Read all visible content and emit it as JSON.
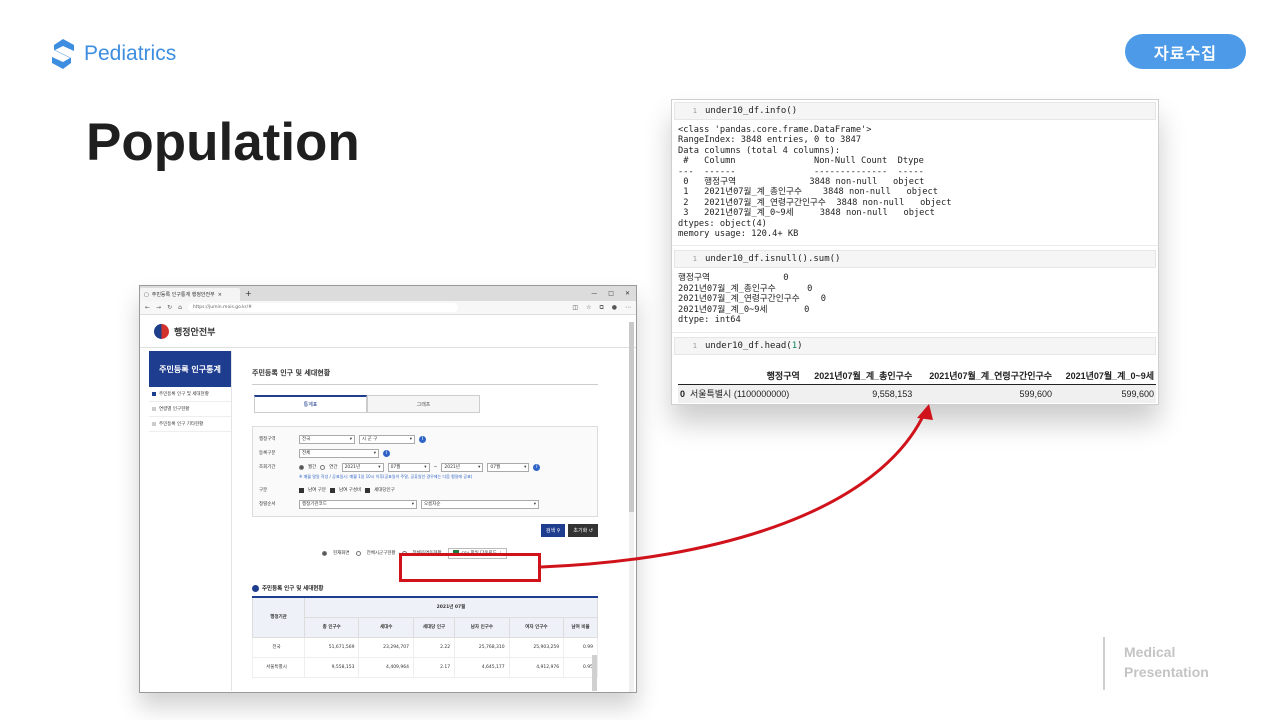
{
  "slide": {
    "brand": "Pediatrics",
    "badge": "자료수집",
    "title": "Population",
    "footer": {
      "line1": "Medical",
      "line2": "Presentation"
    },
    "accent": "#4d9be8",
    "highlight": "#d0121b"
  },
  "browser": {
    "tab_title": "주민등록 인구통계 행정안전부",
    "tab_close": "×",
    "new_tab": "+",
    "window_controls": [
      "—",
      "□",
      "✕"
    ],
    "url": "https://jumin.mois.go.kr/#",
    "nav_icons": [
      "back-icon",
      "forward-icon",
      "refresh-icon",
      "home-icon"
    ],
    "site_name": "행정안전부",
    "sidebar": {
      "title": "주민등록 인구통계",
      "items": [
        "주민등록 인구 및 세대현황",
        "연령별 인구현황",
        "주민등록 인구 기타현황"
      ]
    },
    "page_title": "주민등록 인구 및 세대현황",
    "tabs": [
      "통계표",
      "그래프"
    ],
    "filters": {
      "region_label": "행정구역",
      "region_value": "전국",
      "district_value": "시 군 구",
      "type_label": "등록구분",
      "type_value": "전체",
      "period_label": "조회기간",
      "period_monthly": "월간",
      "period_yearly": "연간",
      "from_year": "2021년",
      "from_month": "07월",
      "tilde": "~",
      "to_year": "2021년",
      "to_month": "07월",
      "note": "※ 매월 말일 작성 / 공표일시: 매월 1일 10시 이후(공표일이 주말, 공휴일인 경우에는 다음 평일에 공표)",
      "category_label": "구분",
      "cat1": "남여 구분",
      "cat2": "남여 구성비",
      "cat3": "세대당인구",
      "sort_label": "정렬순서",
      "sort_value": "행정기관코드",
      "order_value": "오름차순"
    },
    "buttons": {
      "search": "검색",
      "reset": "초기화"
    },
    "options": {
      "current": "현재화면",
      "all_districts": "전체시군구현황",
      "all_dong": "전체읍면동현황",
      "download": "csv 파일 다운로드"
    },
    "section_title": "주민등록 인구 및 세대현황",
    "table": {
      "corner": "행정기관",
      "period": "2021년 07월",
      "columns": [
        "총 인구수",
        "세대수",
        "세대당 인구",
        "남자 인구수",
        "여자 인구수",
        "남여 비율"
      ],
      "rows": [
        [
          "전국",
          "51,671,569",
          "23,294,707",
          "2.22",
          "25,768,310",
          "25,903,259",
          "0.99"
        ],
        [
          "서울특별시",
          "9,558,153",
          "4,409,964",
          "2.17",
          "4,645,177",
          "4,912,976",
          "0.95"
        ]
      ]
    }
  },
  "jupyter": {
    "cells": [
      {
        "num": "1",
        "code": "under10_df.info()",
        "output": "<class 'pandas.core.frame.DataFrame'>\nRangeIndex: 3848 entries, 0 to 3847\nData columns (total 4 columns):\n #   Column               Non-Null Count  Dtype \n---  ------               --------------  ----- \n 0   행정구역              3848 non-null   object\n 1   2021년07월_계_총인구수    3848 non-null   object\n 2   2021년07월_계_연령구간인구수  3848 non-null   object\n 3   2021년07월_계_0~9세     3848 non-null   object\ndtypes: object(4)\nmemory usage: 120.4+ KB"
      },
      {
        "num": "1",
        "code": "under10_df.isnull().sum()",
        "output": "행정구역              0\n2021년07월_계_총인구수      0\n2021년07월_계_연령구간인구수    0\n2021년07월_계_0~9세       0\ndtype: int64"
      },
      {
        "num": "1",
        "code_prefix": "under10_df.head(",
        "code_arg": "1",
        "code_suffix": ")"
      }
    ],
    "head_table": {
      "columns": [
        "행정구역",
        "2021년07월_계_총인구수",
        "2021년07월_계_연령구간인구수",
        "2021년07월_계_0~9세"
      ],
      "rows": [
        [
          "0",
          "서울특별시 (1100000000)",
          "9,558,153",
          "599,600",
          "599,600"
        ]
      ]
    }
  }
}
